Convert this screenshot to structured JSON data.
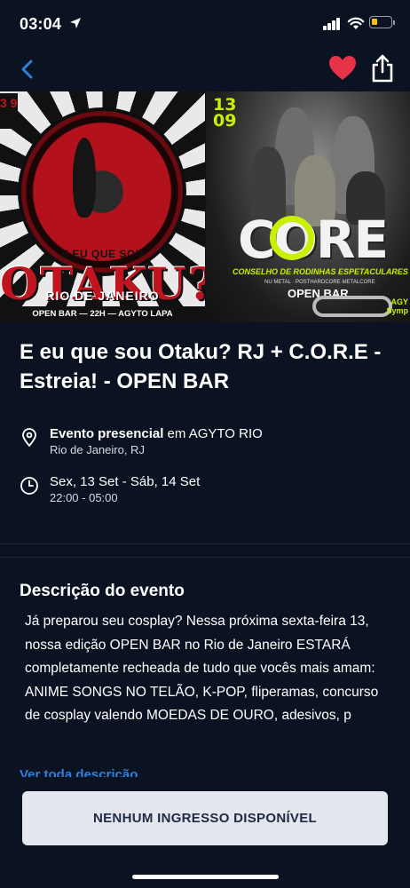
{
  "status_bar": {
    "time": "03:04",
    "battery_color": "#f5c400"
  },
  "nav": {
    "heart_color": "#e63348",
    "back_color": "#2f7fdc"
  },
  "banner": {
    "left": {
      "tag": "3 9",
      "eu_que_sou": "E EU QUE SOU",
      "otaku": "OTAKU?",
      "city": "RIO DE JANEIRO",
      "strip": "OPEN BAR — 22H — AGYTO LAPA"
    },
    "right": {
      "date": "13\n09",
      "core": "CORE",
      "subtitle": "CONSELHO DE RODINHAS ESPETACULARES",
      "subtitle2": "NU METAL · POSTHARDCORE·METALCORE",
      "open_bar": "OPEN BAR",
      "agyto": "AGY\nSymp"
    }
  },
  "event": {
    "title": "E eu que sou Otaku? RJ + C.O.R.E - Estreia! - OPEN BAR",
    "location_type": "Evento presencial",
    "location_connector": " em AGYTO RIO",
    "location_city": "Rio de Janeiro, RJ",
    "date_range": "Sex, 13 Set - Sáb, 14 Set",
    "time_range": "22:00 - 05:00"
  },
  "description": {
    "heading": "Descrição do evento",
    "text": "Já preparou seu cosplay? Nessa próxima sexta-feira 13, nossa edição OPEN BAR no Rio de Janeiro ESTARÁ completamente recheada de tudo que vocês mais amam: ANIME SONGS NO TELÃO, K-POP, fliperamas, concurso de cosplay valendo MOEDAS DE OURO, adesivos, p",
    "see_more": "Ver toda descrição"
  },
  "cta": {
    "label": "NENHUM INGRESSO DISPONÍVEL"
  }
}
